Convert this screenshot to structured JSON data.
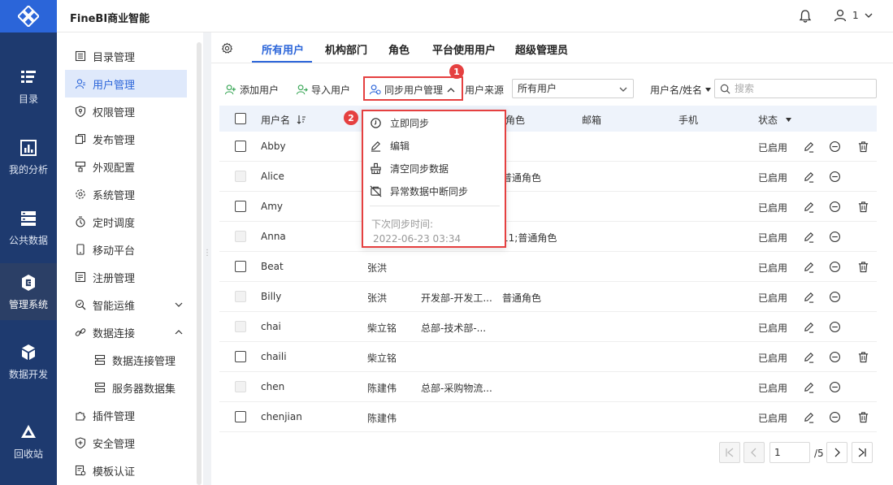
{
  "app": {
    "title": "FineBI商业智能",
    "user_name": "1"
  },
  "rail": {
    "items": [
      {
        "label": "目录",
        "icon": "catalog-icon"
      },
      {
        "label": "我的分析",
        "icon": "analysis-icon"
      },
      {
        "label": "公共数据",
        "icon": "public-data-icon"
      },
      {
        "label": "管理系统",
        "icon": "admin-system-icon",
        "active": true
      },
      {
        "label": "数据开发",
        "icon": "data-dev-icon"
      },
      {
        "label": "回收站",
        "icon": "recycle-bin-icon"
      }
    ]
  },
  "subnav": {
    "items": [
      {
        "label": "目录管理",
        "icon": "catalog-manage-icon"
      },
      {
        "label": "用户管理",
        "icon": "user-manage-icon",
        "active": true
      },
      {
        "label": "权限管理",
        "icon": "permission-icon"
      },
      {
        "label": "发布管理",
        "icon": "publish-icon"
      },
      {
        "label": "外观配置",
        "icon": "appearance-icon"
      },
      {
        "label": "系统管理",
        "icon": "system-gear-icon"
      },
      {
        "label": "定时调度",
        "icon": "timer-icon"
      },
      {
        "label": "移动平台",
        "icon": "mobile-icon"
      },
      {
        "label": "注册管理",
        "icon": "register-icon"
      },
      {
        "label": "智能运维",
        "icon": "ops-icon",
        "expandable": "down"
      },
      {
        "label": "数据连接",
        "icon": "data-link-icon",
        "expandable": "up"
      },
      {
        "label": "数据连接管理",
        "icon": "db-connection-icon",
        "child": true
      },
      {
        "label": "服务器数据集",
        "icon": "server-dataset-icon",
        "child": true
      },
      {
        "label": "插件管理",
        "icon": "plugin-icon"
      },
      {
        "label": "安全管理",
        "icon": "shield-icon"
      },
      {
        "label": "模板认证",
        "icon": "template-auth-icon"
      }
    ]
  },
  "tabs": {
    "items": [
      {
        "label": "所有用户",
        "active": true
      },
      {
        "label": "机构部门"
      },
      {
        "label": "角色"
      },
      {
        "label": "平台使用用户"
      },
      {
        "label": "超级管理员"
      }
    ]
  },
  "toolbar": {
    "add_user": "添加用户",
    "import_user": "导入用户",
    "sync_manage": "同步用户管理",
    "source_label": "用户来源",
    "source_value": "所有用户",
    "search_type": "用户名/姓名",
    "search_placeholder": "搜索"
  },
  "badges": {
    "one": "1",
    "two": "2"
  },
  "table": {
    "headers": {
      "username": "用户名",
      "role": "角色",
      "email": "邮箱",
      "phone": "手机",
      "status": "状态"
    },
    "rows": [
      {
        "username": "Abby",
        "name": "",
        "dept": "",
        "role": "",
        "status": "已启用",
        "disabled": false,
        "deletable": true
      },
      {
        "username": "Alice",
        "name": "",
        "dept": "",
        "role": "普通角色",
        "status": "已启用",
        "disabled": true,
        "deletable": false
      },
      {
        "username": "Amy",
        "name": "",
        "dept": "",
        "role": "",
        "status": "已启用",
        "disabled": false,
        "deletable": true
      },
      {
        "username": "Anna",
        "name": "",
        "dept": "",
        "role": "11;普通角色",
        "status": "已启用",
        "disabled": true,
        "deletable": false
      },
      {
        "username": "Beat",
        "name": "张洪",
        "dept": "",
        "role": "",
        "status": "已启用",
        "disabled": false,
        "deletable": true
      },
      {
        "username": "Billy",
        "name": "张洪",
        "dept": "开发部-开发工...",
        "role": "普通角色",
        "status": "已启用",
        "disabled": true,
        "deletable": false
      },
      {
        "username": "chai",
        "name": "柴立铭",
        "dept": "总部-技术部-...",
        "role": "",
        "status": "已启用",
        "disabled": true,
        "deletable": false
      },
      {
        "username": "chaili",
        "name": "柴立铭",
        "dept": "",
        "role": "",
        "status": "已启用",
        "disabled": false,
        "deletable": true
      },
      {
        "username": "chen",
        "name": "陈建伟",
        "dept": "总部-采购物流...",
        "role": "",
        "status": "已启用",
        "disabled": true,
        "deletable": false
      },
      {
        "username": "chenjian",
        "name": "陈建伟",
        "dept": "",
        "role": "",
        "status": "已启用",
        "disabled": false,
        "deletable": true
      }
    ]
  },
  "dropdown": {
    "sync_now": "立即同步",
    "edit": "编辑",
    "clear_sync": "清空同步数据",
    "abort_sync": "异常数据中断同步",
    "next_label": "下次同步时间:",
    "next_time": "2022-06-23 03:34"
  },
  "pagination": {
    "current": "1",
    "total": "/5"
  },
  "colors": {
    "accent": "#2b65d9",
    "rail": "#1e3a6f",
    "highlight": "#e54040"
  }
}
